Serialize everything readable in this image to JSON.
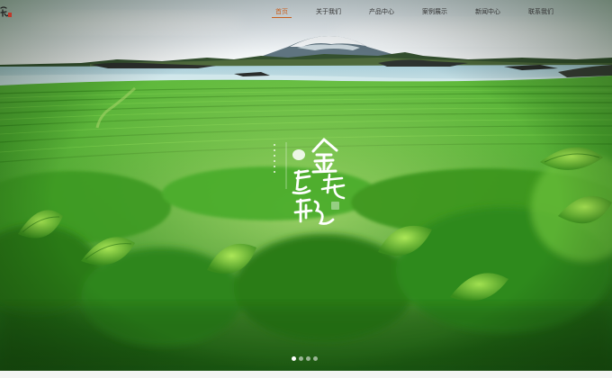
{
  "header": {
    "logo_icon": "calligraphy-seal-logo",
    "nav": [
      {
        "label": "首页",
        "active": true
      },
      {
        "label": "关于我们",
        "active": false
      },
      {
        "label": "产品中心",
        "active": false
      },
      {
        "label": "案例展示",
        "active": false
      },
      {
        "label": "新闻中心",
        "active": false
      },
      {
        "label": "联系我们",
        "active": false
      }
    ]
  },
  "banner": {
    "calligraphy_title": "金坑烏龍",
    "slides_total": 4,
    "slide_active": 1
  },
  "colors": {
    "nav_active": "#c8601e",
    "nav_text": "#333333",
    "tea_field": "#3fa82a"
  }
}
